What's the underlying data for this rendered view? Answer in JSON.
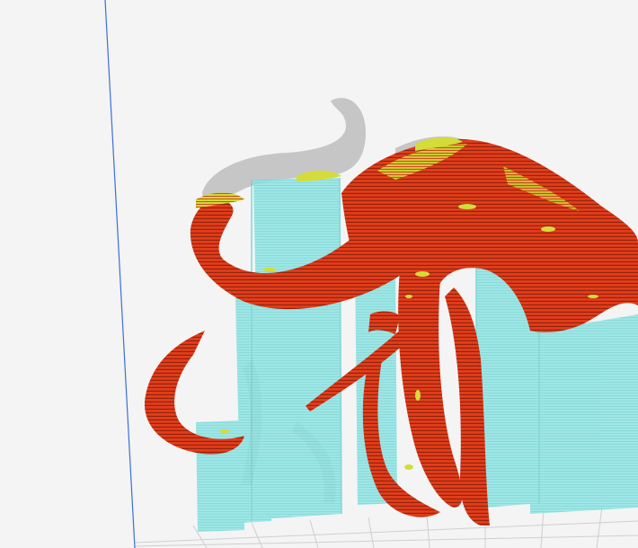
{
  "viewport": {
    "view": "layer-view",
    "background": "#f4f4f4"
  },
  "colors": {
    "model_shell": "#e23d1a",
    "model_shell_dark": "#b02a10",
    "model_top_skin": "#d4dc3a",
    "support": "#8fe3e3",
    "support_edge": "#5cc8c8",
    "model_shadow": "#bdbdbd",
    "build_volume_edge": "#3b6fd8",
    "build_plate_grid": "#c9c9c9"
  },
  "icons": {
    "model": "mammoth-model-icon",
    "supports": "support-structure-icon"
  }
}
